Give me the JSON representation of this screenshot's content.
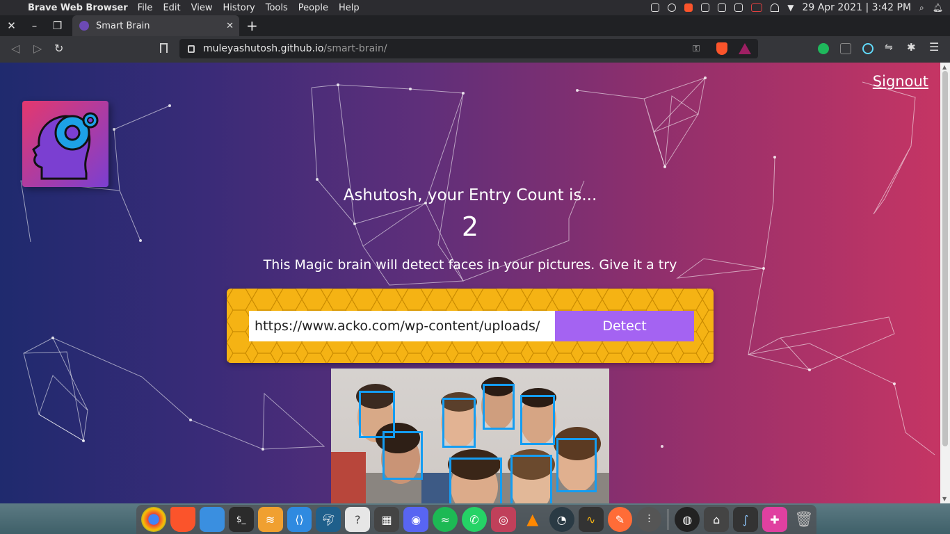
{
  "os_menubar": {
    "app_name": "Brave Web Browser",
    "menus": [
      "File",
      "Edit",
      "View",
      "History",
      "Tools",
      "People",
      "Help"
    ],
    "clock": "29 Apr 2021 | 3:42 PM"
  },
  "browser": {
    "tab_title": "Smart Brain",
    "url_host": "muleyashutosh.github.io",
    "url_path": "/smart-brain/"
  },
  "page": {
    "signout_label": "Signout",
    "entry_text": "Ashutosh, your Entry Count is...",
    "entry_count": "2",
    "tagline": "This Magic brain will detect faces in your pictures. Give it a try",
    "image_url_value": "https://www.acko.com/wp-content/uploads/",
    "detect_label": "Detect",
    "face_box_count": 10
  },
  "colors": {
    "gradient_start": "#1f2a6e",
    "gradient_end": "#c53564",
    "panel_yellow": "#f5b314",
    "detect_purple": "#a463f2",
    "face_box_blue": "#149df2"
  },
  "dock": {
    "apps": [
      "chrome-icon",
      "brave-icon",
      "files-icon",
      "terminal-icon",
      "sublime-icon",
      "vscode-icon",
      "mysql-workbench-icon",
      "help-icon",
      "calculator-icon",
      "discord-icon",
      "spotify-icon",
      "whatsapp-icon",
      "camera-icon",
      "vlc-icon",
      "speedometer-icon",
      "system-monitor-icon",
      "postman-icon",
      "mixer-icon",
      "obs-icon",
      "screenshot-icon",
      "drawing-icon",
      "photo-icon",
      "trash-icon"
    ]
  }
}
